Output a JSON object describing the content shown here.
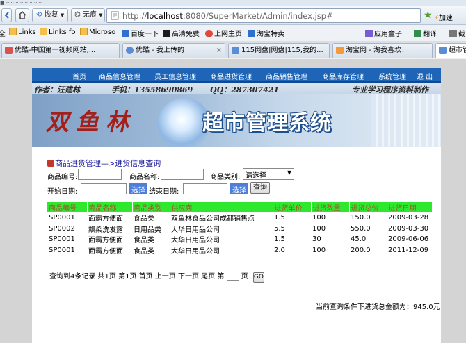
{
  "browser": {
    "title_fragment": "■ ·· ·· ·· ·· ··  ·· ·· ··",
    "nav": {
      "back_label": "",
      "forward_label": "",
      "home_label": "",
      "restore_label": "恢复",
      "notrace_label": "无痕"
    },
    "address": {
      "url_prefix": "http://",
      "url_host": "localhost",
      "url_rest": ":8080/SuperMarket/Admin/index.jsp#",
      "accelerate_label": "加速"
    },
    "bookmarks": [
      {
        "label": "全",
        "icon": "folder-icon"
      },
      {
        "label": "Links",
        "icon": "folder-icon"
      },
      {
        "label": "Links fo",
        "icon": "folder-icon"
      },
      {
        "label": "Microso",
        "icon": "folder-icon"
      },
      {
        "label": "百度一下",
        "icon": "baidu-icon"
      },
      {
        "label": "高清免费",
        "icon": "m-icon"
      },
      {
        "label": "上网主页",
        "icon": "home-icon"
      },
      {
        "label": "淘宝特卖",
        "icon": "taobao-icon"
      },
      {
        "label": "应用盒子",
        "icon": "app-box-icon"
      },
      {
        "label": "翻译",
        "icon": "translate-icon"
      },
      {
        "label": "截",
        "icon": "scissors-icon"
      }
    ],
    "tabs": [
      {
        "label": "优酷-中国第一视频网站,...",
        "color": "#d9534f"
      },
      {
        "label": "优酷 - 我上传的",
        "color": "#5b8dd6"
      },
      {
        "label": "115网盘|网盘|115,我的...",
        "color": "#5b8dd6"
      },
      {
        "label": "淘宝网 - 淘我喜欢！",
        "color": "#f39a3b"
      },
      {
        "label": "超市管",
        "color": "#5b8dd6"
      }
    ]
  },
  "site": {
    "menu": [
      "首页",
      "商品信息管理",
      "员工信息管理",
      "商品进货管理",
      "商品销售管理",
      "商品库存管理",
      "系统管理",
      "退 出"
    ],
    "banner": {
      "author": "作者：汪建林",
      "phone": "手机：13558690869",
      "qq": "QQ：287307421",
      "slogan": "专业学习程序资料制作",
      "brand": "双鱼林",
      "title": "超市管理系统"
    },
    "breadcrumb": "商品进货管理—>进货信息查询",
    "search": {
      "code_label": "商品编号:",
      "name_label": "商品名称:",
      "category_label": "商品类别:",
      "category_value": "请选择",
      "start_label": "开始日期:",
      "pick_label": "选择",
      "end_label": "结束日期:",
      "pick_label2": "选择",
      "query_label": "查询"
    },
    "table": {
      "headers": [
        "商品编号",
        "商品名称",
        "商品类别",
        "供应商",
        "进货单价",
        "进货数量",
        "进货总价",
        "进货日期"
      ],
      "rows": [
        [
          "SP0001",
          "面霸方便面",
          "食品类",
          "双鱼林食品公司成都销售点",
          "1.5",
          "100",
          "150.0",
          "2009-03-28"
        ],
        [
          "SP0002",
          "飘柔洗发露",
          "日用品类",
          "大华日用品公司",
          "5.5",
          "100",
          "550.0",
          "2009-03-30"
        ],
        [
          "SP0001",
          "面霸方便面",
          "食品类",
          "大华日用品公司",
          "1.5",
          "30",
          "45.0",
          "2009-06-06"
        ],
        [
          "SP0001",
          "面霸方便面",
          "食品类",
          "大华日用品公司",
          "2.0",
          "100",
          "200.0",
          "2011-12-09"
        ]
      ]
    },
    "pager": {
      "summary": "查询到4条记录 共1页 第1页 首页 上一页 下一页 尾页 第",
      "page_suffix": "页",
      "go_label": "GO"
    },
    "total": "当前查询条件下进货总金额为：945.0元"
  }
}
